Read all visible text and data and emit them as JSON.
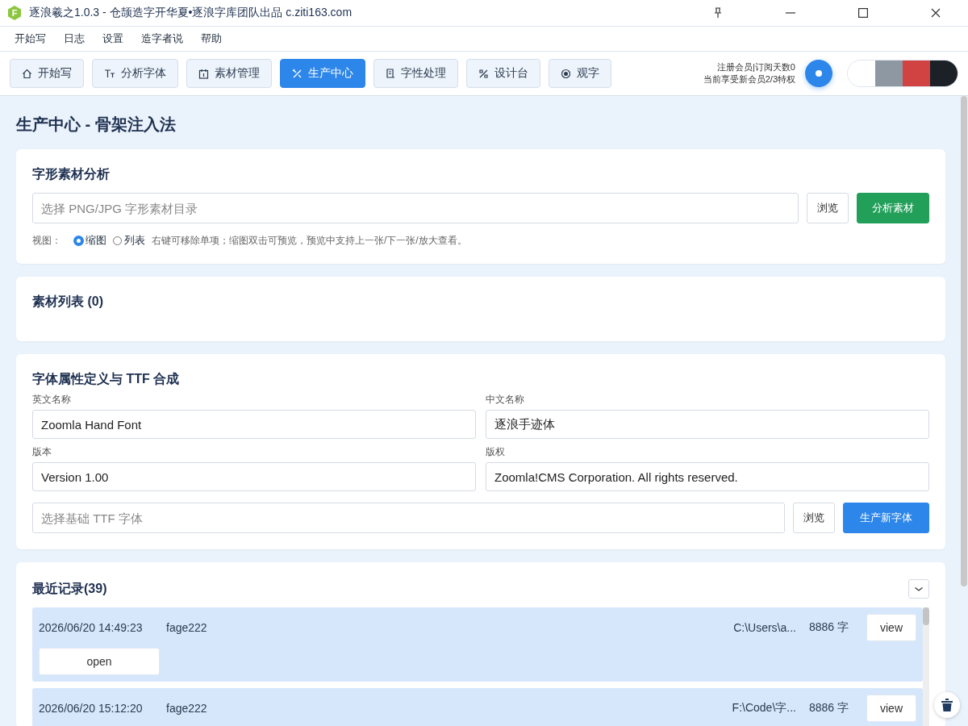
{
  "window": {
    "logo_letter": "F",
    "title": "逐浪羲之1.0.3 - 仓颉造字开华夏•逐浪字库团队出品 c.ziti163.com"
  },
  "menu": [
    "开始写",
    "日志",
    "设置",
    "造字者说",
    "帮助"
  ],
  "tabs": [
    {
      "label": "开始写",
      "selected": false
    },
    {
      "label": "分析字体",
      "selected": false
    },
    {
      "label": "素材管理",
      "selected": false
    },
    {
      "label": "生产中心",
      "selected": true
    },
    {
      "label": "字性处理",
      "selected": false
    },
    {
      "label": "设计台",
      "selected": false
    },
    {
      "label": "观字",
      "selected": false
    }
  ],
  "member": {
    "line1": "注册会员|订阅天数0",
    "line2": "当前享受新会员2/3特权"
  },
  "themes": [
    {
      "color": "#ffffff"
    },
    {
      "color": "#8e98a3"
    },
    {
      "color": "#d14343"
    },
    {
      "color": "#1c2128"
    }
  ],
  "page_title": "生产中心 - 骨架注入法",
  "analysis": {
    "title": "字形素材分析",
    "placeholder": "选择 PNG/JPG 字形素材目录",
    "browse": "浏览",
    "analyze": "分析素材",
    "view_label": "视图：",
    "views": [
      {
        "label": "缩图",
        "selected": true
      },
      {
        "label": "列表",
        "selected": false
      }
    ],
    "hint": "右键可移除单项；缩图双击可预览，预览中支持上一张/下一张/放大查看。"
  },
  "materials": {
    "title": "素材列表 (0)"
  },
  "font_def": {
    "title": "字体属性定义与 TTF 合成",
    "fields": [
      {
        "label": "英文名称",
        "value": "Zoomla Hand Font"
      },
      {
        "label": "中文名称",
        "value": "逐浪手迹体"
      },
      {
        "label": "版本",
        "value": "Version 1.00"
      },
      {
        "label": "版权",
        "value": "Zoomla!CMS Corporation. All rights reserved."
      }
    ],
    "base_placeholder": "选择基础 TTF 字体",
    "browse": "浏览",
    "generate": "生产新字体"
  },
  "records": {
    "title": "最近记录(39)",
    "items": [
      {
        "time": "2026/06/20 14:49:23",
        "user": "fage222",
        "path": "C:\\Users\\a...",
        "count": "8886 字",
        "view": "view",
        "open": "open"
      },
      {
        "time": "2026/06/20 15:12:20",
        "user": "fage222",
        "path": "F:\\Code\\字...",
        "count": "8886 字",
        "view": "view"
      }
    ]
  }
}
